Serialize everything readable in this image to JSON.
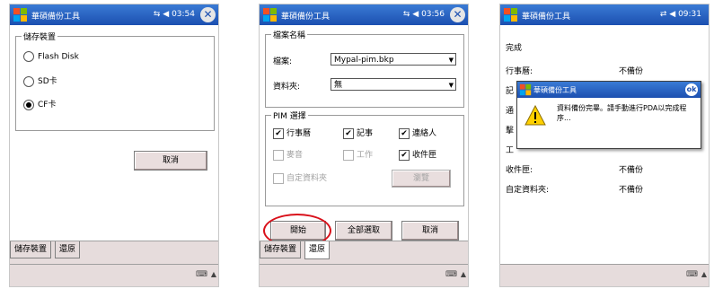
{
  "screen1": {
    "title": "華碩備份工具",
    "status": "03:54",
    "group_title": "儲存裝置",
    "options": [
      {
        "label": "Flash Disk",
        "selected": false
      },
      {
        "label": "SD卡",
        "selected": false
      },
      {
        "label": "CF卡",
        "selected": true
      }
    ],
    "cancel_label": "取消",
    "tabs": [
      "儲存裝置",
      "還原"
    ],
    "active_tab": 0
  },
  "screen2": {
    "title": "華碩備份工具",
    "status": "03:56",
    "file_group_title": "檔案名稱",
    "file_label": "檔案:",
    "file_value": "Mypal-pim.bkp",
    "folder_label": "資料夾:",
    "folder_value": "無",
    "pim_group_title": "PIM 選擇",
    "pim_items": [
      {
        "label": "行事曆",
        "checked": true,
        "enabled": true
      },
      {
        "label": "記事",
        "checked": true,
        "enabled": true
      },
      {
        "label": "連絡人",
        "checked": true,
        "enabled": true
      },
      {
        "label": "麥音",
        "checked": false,
        "enabled": false
      },
      {
        "label": "工作",
        "checked": false,
        "enabled": false
      },
      {
        "label": "收件匣",
        "checked": true,
        "enabled": true
      }
    ],
    "custom_folder_label": "自定資料夾",
    "browse_label": "瀏覽",
    "start_label": "開始",
    "select_all_label": "全部選取",
    "cancel_label": "取消",
    "tabs": [
      "儲存裝置",
      "還原"
    ],
    "active_tab": 1
  },
  "screen3": {
    "title": "華碩備份工具",
    "status": "09:31",
    "header": "完成",
    "rows": [
      {
        "label": "行事曆:",
        "value": "不備份"
      },
      {
        "label": "記",
        "value": ""
      },
      {
        "label": "通",
        "value": ""
      },
      {
        "label": "擊",
        "value": ""
      },
      {
        "label": "工",
        "value": ""
      },
      {
        "label": "收件匣:",
        "value": "不備份"
      },
      {
        "label": "自定資料夾:",
        "value": "不備份"
      }
    ],
    "dialog": {
      "title": "華碩備份工具",
      "ok_label": "ok",
      "message": "資料備份完畢。請手動進行PDA以完成程序..."
    }
  },
  "colors": {
    "title_bar": "#1c4fb0",
    "highlight_oval": "#d9101a",
    "button_face": "#e9dede"
  }
}
